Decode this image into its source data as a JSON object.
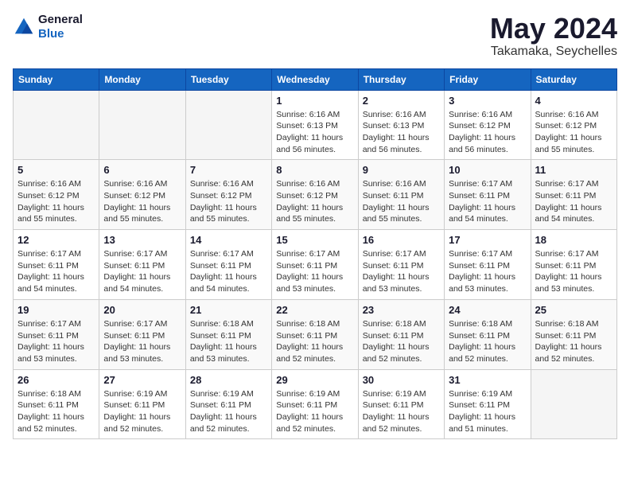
{
  "logo": {
    "general": "General",
    "blue": "Blue"
  },
  "title": "May 2024",
  "subtitle": "Takamaka, Seychelles",
  "weekdays": [
    "Sunday",
    "Monday",
    "Tuesday",
    "Wednesday",
    "Thursday",
    "Friday",
    "Saturday"
  ],
  "weeks": [
    [
      {
        "day": "",
        "info": ""
      },
      {
        "day": "",
        "info": ""
      },
      {
        "day": "",
        "info": ""
      },
      {
        "day": "1",
        "info": "Sunrise: 6:16 AM\nSunset: 6:13 PM\nDaylight: 11 hours and 56 minutes."
      },
      {
        "day": "2",
        "info": "Sunrise: 6:16 AM\nSunset: 6:13 PM\nDaylight: 11 hours and 56 minutes."
      },
      {
        "day": "3",
        "info": "Sunrise: 6:16 AM\nSunset: 6:12 PM\nDaylight: 11 hours and 56 minutes."
      },
      {
        "day": "4",
        "info": "Sunrise: 6:16 AM\nSunset: 6:12 PM\nDaylight: 11 hours and 55 minutes."
      }
    ],
    [
      {
        "day": "5",
        "info": "Sunrise: 6:16 AM\nSunset: 6:12 PM\nDaylight: 11 hours and 55 minutes."
      },
      {
        "day": "6",
        "info": "Sunrise: 6:16 AM\nSunset: 6:12 PM\nDaylight: 11 hours and 55 minutes."
      },
      {
        "day": "7",
        "info": "Sunrise: 6:16 AM\nSunset: 6:12 PM\nDaylight: 11 hours and 55 minutes."
      },
      {
        "day": "8",
        "info": "Sunrise: 6:16 AM\nSunset: 6:12 PM\nDaylight: 11 hours and 55 minutes."
      },
      {
        "day": "9",
        "info": "Sunrise: 6:16 AM\nSunset: 6:11 PM\nDaylight: 11 hours and 55 minutes."
      },
      {
        "day": "10",
        "info": "Sunrise: 6:17 AM\nSunset: 6:11 PM\nDaylight: 11 hours and 54 minutes."
      },
      {
        "day": "11",
        "info": "Sunrise: 6:17 AM\nSunset: 6:11 PM\nDaylight: 11 hours and 54 minutes."
      }
    ],
    [
      {
        "day": "12",
        "info": "Sunrise: 6:17 AM\nSunset: 6:11 PM\nDaylight: 11 hours and 54 minutes."
      },
      {
        "day": "13",
        "info": "Sunrise: 6:17 AM\nSunset: 6:11 PM\nDaylight: 11 hours and 54 minutes."
      },
      {
        "day": "14",
        "info": "Sunrise: 6:17 AM\nSunset: 6:11 PM\nDaylight: 11 hours and 54 minutes."
      },
      {
        "day": "15",
        "info": "Sunrise: 6:17 AM\nSunset: 6:11 PM\nDaylight: 11 hours and 53 minutes."
      },
      {
        "day": "16",
        "info": "Sunrise: 6:17 AM\nSunset: 6:11 PM\nDaylight: 11 hours and 53 minutes."
      },
      {
        "day": "17",
        "info": "Sunrise: 6:17 AM\nSunset: 6:11 PM\nDaylight: 11 hours and 53 minutes."
      },
      {
        "day": "18",
        "info": "Sunrise: 6:17 AM\nSunset: 6:11 PM\nDaylight: 11 hours and 53 minutes."
      }
    ],
    [
      {
        "day": "19",
        "info": "Sunrise: 6:17 AM\nSunset: 6:11 PM\nDaylight: 11 hours and 53 minutes."
      },
      {
        "day": "20",
        "info": "Sunrise: 6:17 AM\nSunset: 6:11 PM\nDaylight: 11 hours and 53 minutes."
      },
      {
        "day": "21",
        "info": "Sunrise: 6:18 AM\nSunset: 6:11 PM\nDaylight: 11 hours and 53 minutes."
      },
      {
        "day": "22",
        "info": "Sunrise: 6:18 AM\nSunset: 6:11 PM\nDaylight: 11 hours and 52 minutes."
      },
      {
        "day": "23",
        "info": "Sunrise: 6:18 AM\nSunset: 6:11 PM\nDaylight: 11 hours and 52 minutes."
      },
      {
        "day": "24",
        "info": "Sunrise: 6:18 AM\nSunset: 6:11 PM\nDaylight: 11 hours and 52 minutes."
      },
      {
        "day": "25",
        "info": "Sunrise: 6:18 AM\nSunset: 6:11 PM\nDaylight: 11 hours and 52 minutes."
      }
    ],
    [
      {
        "day": "26",
        "info": "Sunrise: 6:18 AM\nSunset: 6:11 PM\nDaylight: 11 hours and 52 minutes."
      },
      {
        "day": "27",
        "info": "Sunrise: 6:19 AM\nSunset: 6:11 PM\nDaylight: 11 hours and 52 minutes."
      },
      {
        "day": "28",
        "info": "Sunrise: 6:19 AM\nSunset: 6:11 PM\nDaylight: 11 hours and 52 minutes."
      },
      {
        "day": "29",
        "info": "Sunrise: 6:19 AM\nSunset: 6:11 PM\nDaylight: 11 hours and 52 minutes."
      },
      {
        "day": "30",
        "info": "Sunrise: 6:19 AM\nSunset: 6:11 PM\nDaylight: 11 hours and 52 minutes."
      },
      {
        "day": "31",
        "info": "Sunrise: 6:19 AM\nSunset: 6:11 PM\nDaylight: 11 hours and 51 minutes."
      },
      {
        "day": "",
        "info": ""
      }
    ]
  ]
}
